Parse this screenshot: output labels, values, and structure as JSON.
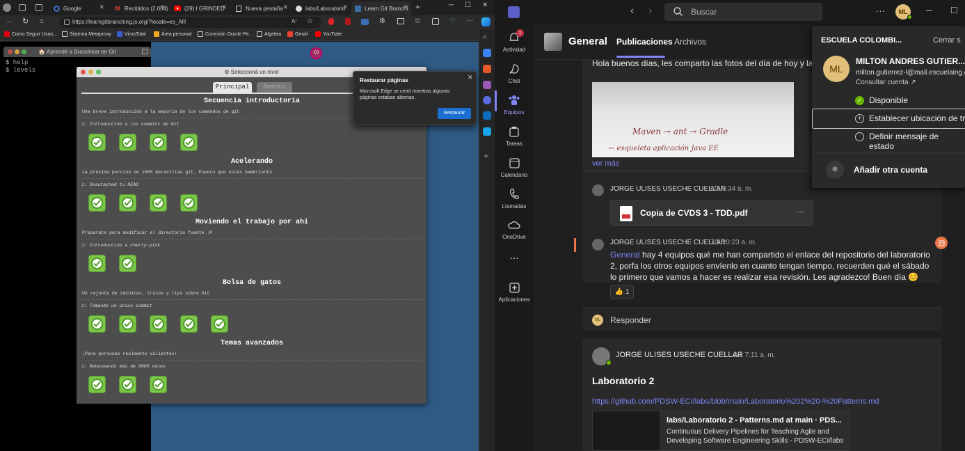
{
  "edge": {
    "tabs": [
      {
        "title": "Google",
        "icon": "google-icon"
      },
      {
        "title": "Recibidos (2.054)",
        "icon": "gmail-icon"
      },
      {
        "title": "(29) I GRINDED",
        "icon": "youtube-icon"
      },
      {
        "title": "Nueva pestaña",
        "icon": "newtab-icon"
      },
      {
        "title": "labs/Laboratorio",
        "icon": "github-icon"
      },
      {
        "title": "Learn Git Branchi",
        "icon": "gitbranch-icon"
      }
    ],
    "new_tab_label": "+",
    "url": "https://learngitbranching.js.org/?locale=es_AR",
    "bookmarks": [
      "Como Seguir Usan...",
      "Sistema Metaproxy",
      "VirusTotal",
      "Área personal",
      "Conexión Oracle Pe...",
      "Algebra",
      "Gmail",
      "YouTube"
    ],
    "popup": {
      "title": "Restaurar páginas",
      "body": "Microsoft Edge se cerró mientras algunas páginas estaban abiertas.",
      "button": "Restaurar"
    }
  },
  "gitapp": {
    "terminal_title": "🏠 Aprendé a Branchear en Git",
    "terminal_lines": [
      "$ help",
      "$ levels"
    ],
    "avatar_label": "C0",
    "level_window": {
      "title": "⚙ Seleccioná un nivel",
      "tabs": [
        "Principal",
        "Remoto"
      ],
      "sections": [
        {
          "title": "Secuencia introductoria",
          "desc": "Una breve introducción a la mayoría de los comandos de git",
          "sub": "1: Introducción a los commits de Git",
          "levels": 4
        },
        {
          "title": "Acelerando",
          "desc": "La próxima porción de 100% maravillas git. Espero que estés hambriento",
          "sub": "1: Desatached tu HEAD",
          "levels": 4
        },
        {
          "title": "Moviendo el trabajo por ahí",
          "desc": "Preparate para modificar el directorio fuente :P",
          "sub": "1: Introducción a cherry-pick",
          "levels": 2
        },
        {
          "title": "Bolsa de gatos",
          "desc": "Un rejunte de técnicas, trucos y tips sobre Git",
          "sub": "1: Tomando un único commit",
          "levels": 5
        },
        {
          "title": "Temas avanzados",
          "desc": "¡Para personas realmente valientes!",
          "sub": "1: Rebaseando más de 9000 veces",
          "levels": 3
        }
      ]
    }
  },
  "teams": {
    "search_placeholder": "Buscar",
    "rail": [
      {
        "label": "Actividad",
        "icon": "bell-icon",
        "badge": "1"
      },
      {
        "label": "Chat",
        "icon": "chat-icon"
      },
      {
        "label": "Equipos",
        "icon": "teams-icon"
      },
      {
        "label": "Tareas",
        "icon": "tasks-icon"
      },
      {
        "label": "Calendario",
        "icon": "calendar-icon"
      },
      {
        "label": "Llamadas",
        "icon": "phone-icon"
      },
      {
        "label": "OneDrive",
        "icon": "cloud-icon"
      },
      {
        "label": "...",
        "icon": "more-icon"
      },
      {
        "label": "Aplicaciones",
        "icon": "apps-icon"
      }
    ],
    "channel": {
      "name": "General",
      "tabs": [
        "Publicaciones",
        "Archivos"
      ]
    },
    "posts": {
      "first_text": "Hola buenos días, les comparto las fotos del día de hoy y la pres",
      "whiteboard_line1": "Maven → ant → Gradle",
      "whiteboard_line2": "← esqueleta aplicación Java EE",
      "see_more": "ver más",
      "reply1": {
        "author": "JORGE ULISES USECHE CUELLAR",
        "time": "6/2 9:34 a. m.",
        "file": "Copia de CVDS 3 - TDD.pdf",
        "more": "···"
      },
      "reply2": {
        "author": "JORGE ULISES USECHE CUELLAR",
        "time": "7/2 10:23 a. m.",
        "mention": "General",
        "text": " hay 4 equipos qué me han compartido el enlace del repositorio del laboratorio 2, porfa los otros equipos envíenlo en cuanto tengan tiempo, recuerden qué el sábado lo primero que vamos a hacer es realizar esa revisión. Les agradezco! Buen día",
        "emoji": "😊",
        "reaction": "👍 1"
      },
      "reply_box": "Responder",
      "reply_avatar": "ML",
      "post2": {
        "author": "JORGE ULISES USECHE CUELLAR",
        "time": "3/2 7:11 a. m.",
        "title": "Laboratorio 2",
        "link": "https://github.com/PDSW-ECI/labs/blob/main/Laboratorio%202%20-%20Patterns.md",
        "preview_title": "labs/Laboratorio 2 - Patterns.md at main · PDS...",
        "preview_desc": "Continuous Delivery Pipelines for Teaching Agile and Developing Software Engineering Skills - PDSW-ECI/labs"
      }
    },
    "profile": {
      "org": "ESCUELA COLOMBI...",
      "signout": "Cerrar s",
      "initials": "ML",
      "name": "MILTON ANDRES GUTIER...",
      "email": "milton.gutierrez-l@mail.escuelaing.ec",
      "account": "Consultar cuenta",
      "status": "Disponible",
      "location": "Establecer ubicación de trab",
      "message": "Definir mensaje de estado",
      "add": "Añadir otra cuenta"
    },
    "user_initials": "ML"
  }
}
